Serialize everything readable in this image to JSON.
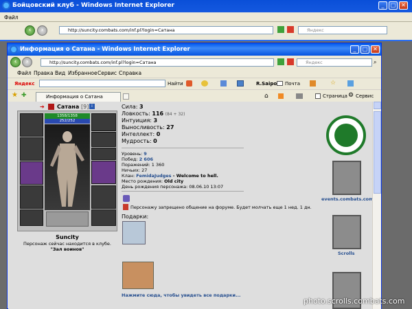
{
  "back_window": {
    "title": "Бойцовский клуб - Windows Internet Explorer",
    "address": "http://suncity.combats.com/inf.pl?login=Сатана",
    "menu_label": "Файл",
    "search_placeholder": "Яндекс"
  },
  "window": {
    "title": "Информация о Сатана - Windows Internet Explorer",
    "address": "http://suncity.combats.com/inf.pl?login=Сатана",
    "search_placeholder": "Яндекс"
  },
  "menu": [
    "Файл",
    "Правка",
    "Вид",
    "Избранное",
    "Сервис",
    "Справка"
  ],
  "toolbar": {
    "yandex_label": "Яндекс",
    "find_label": "Найти",
    "user_label": "R.Saipov",
    "mail_label": "Почта"
  },
  "tab": {
    "label": "Информация о Сатана"
  },
  "command_bar": {
    "page_label": "Страница",
    "service_label": "Сервис"
  },
  "character": {
    "name": "Сатана",
    "level": "[9]",
    "hp": "1358/1358",
    "mana": "252/252",
    "display_name": "Suncity",
    "location_text": "Персонаж сейчас находится в клубе.",
    "location_room": "\"Зал воинов\""
  },
  "stats": [
    {
      "label": "Сила:",
      "value": "3",
      "extra": ""
    },
    {
      "label": "Ловкость:",
      "value": "116",
      "extra": "(84 + 32)"
    },
    {
      "label": "Интуиция:",
      "value": "3",
      "extra": ""
    },
    {
      "label": "Выносливость:",
      "value": "27",
      "extra": ""
    },
    {
      "label": "Интеллект:",
      "value": "0",
      "extra": ""
    },
    {
      "label": "Мудрость:",
      "value": "0",
      "extra": ""
    }
  ],
  "info": {
    "level": {
      "label": "Уровень:",
      "value": "9"
    },
    "wins": {
      "label": "Побед:",
      "value": "2 606"
    },
    "losses": {
      "label": "Поражений:",
      "value": "1 360"
    },
    "draws": {
      "label": "Ничьих:",
      "value": "27"
    },
    "clan": {
      "label": "Клан:",
      "value": "FemidaJudges",
      "tail": " - Welcome to hell."
    },
    "birthplace": {
      "label": "Место рождения:",
      "value": "Old city"
    },
    "birthday": {
      "label": "День рождения персонажа:",
      "value": "08.06.10 13:07"
    }
  },
  "forum_ban": "Персонажу запрещено общение на форуме. Будет молчать еще 1 нед. 1 дн.",
  "gifts": {
    "title": "Подарки:",
    "link": "Нажмите сюда, чтобы увидеть все подарки..."
  },
  "sidebar": {
    "events_label": "events.combats.com",
    "scrolls_label": "Scrolls"
  },
  "watermark": "photo.scrolls.combats.com",
  "colors": {
    "accent": "#244d8e",
    "title_bar": "#0058ee",
    "logo_green": "#1f7a2a"
  },
  "icons": [
    "internet-explorer-icon",
    "back-icon",
    "forward-icon",
    "refresh-icon",
    "stop-icon",
    "star-icon",
    "add-favorite-icon",
    "home-icon",
    "rss-icon",
    "print-icon",
    "gear-icon"
  ]
}
